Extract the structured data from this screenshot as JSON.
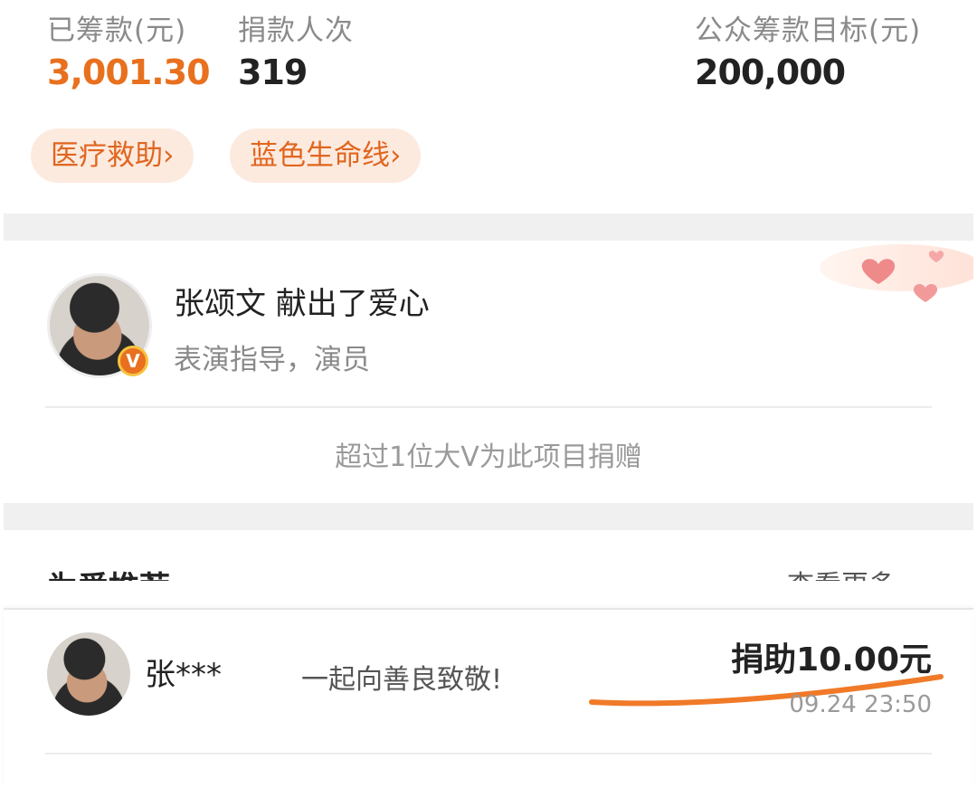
{
  "stats": [
    {
      "label": "已筹款(元)",
      "value": "3,001.30",
      "color": "#e8701e"
    },
    {
      "label": "捐款人次",
      "value": "319",
      "color": "#222222"
    },
    {
      "label": "公众筹款目标(元)",
      "value": "200,000",
      "color": "#222222"
    }
  ],
  "tags": [
    "医疗救助›",
    "蓝色生命线›"
  ],
  "celebrity": {
    "name": "张颂文",
    "action": "献出了爱心",
    "subtitle": "表演指导，演员",
    "badge": "V",
    "more_text": "超过1位大V为此项目捐赠"
  },
  "recommend": {
    "title": "为爱推荐",
    "more": "查看更多"
  },
  "donation": {
    "donor": "张***",
    "message": "一起向善良致敬!",
    "amount": "捐助10.00元",
    "time": "09.24 23:50"
  },
  "colors": {
    "accent": "#e8701e",
    "tag_bg": "#fdeadf",
    "underline": "#f07a28"
  }
}
